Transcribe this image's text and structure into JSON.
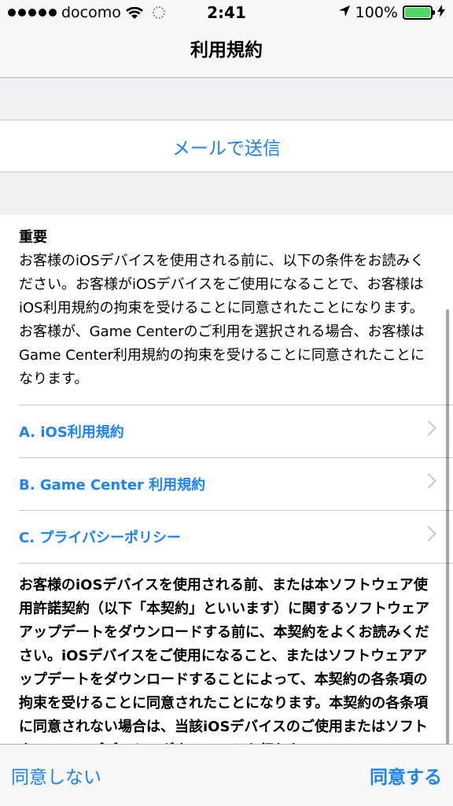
{
  "status_bar": {
    "carrier": "docomo",
    "time": "2:41",
    "battery": "100%",
    "signal_dots": 5
  },
  "nav": {
    "title": "利用規約"
  },
  "mail_button": "メールで送信",
  "heading": "重要",
  "intro": "お客様のiOSデバイスを使用される前に、以下の条件をお読みください。お客様がiOSデバイスをご使用になることで、お客様はiOS利用規約の拘束を受けることに同意されたことになります。お客様が、Game Centerのご利用を選択される場合、お客様はGame Center利用規約の拘束を受けることに同意されたことになります。",
  "links": [
    {
      "label": "A. iOS利用規約"
    },
    {
      "label": "B. Game Center 利用規約"
    },
    {
      "label": "C. プライバシーポリシー"
    }
  ],
  "body": "お客様のiOSデバイスを使用される前、または本ソフトウェア使用許諾契約（以下「本契約」といいます）に関するソフトウェアアップデートをダウンロードする前に、本契約をよくお読みください。iOSデバイスをご使用になること、またはソフトウェアアップデートをダウンロードすることによって、本契約の各条項の拘束を受けることに同意されたことになります。本契約の各条項に同意されない場合は、当該iOSデバイスのご使用またはソフトウェアアップデートのダウンロードを行わない",
  "toolbar": {
    "disagree": "同意しない",
    "agree": "同意する"
  },
  "colors": {
    "accent": "#1a82fb",
    "battery": "#4cd964"
  },
  "icons": [
    "wifi-icon",
    "activity-spinner-icon",
    "location-arrow-icon",
    "charging-bolt-icon",
    "chevron-right-icon"
  ]
}
